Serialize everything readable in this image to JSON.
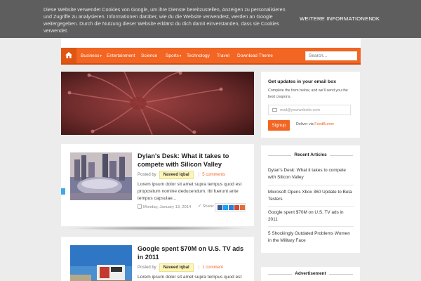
{
  "cookie": {
    "text": "Diese Website verwendet Cookies von Google, um ihre Dienste bereitzustellen, Anzeigen zu personalisieren und Zugriffe zu analysieren. Informationen darüber, wie du die Website verwendest, werden an Google weitergegeben. Durch die Nutzung dieser Website erklärst du dich damit einverstanden, dass sie Cookies verwendet.",
    "more_label": "WEITERE INFORMATIONEN",
    "ok_label": "OK"
  },
  "nav": {
    "home_icon": "home-icon",
    "items": [
      {
        "label": "Business",
        "caret": "▾"
      },
      {
        "label": "Entertainment"
      },
      {
        "label": "Science"
      },
      {
        "label": "Sports",
        "caret": "▾"
      },
      {
        "label": "Technology"
      },
      {
        "label": "Travel"
      },
      {
        "label": "Download Theme"
      }
    ],
    "search_placeholder": "Search..."
  },
  "posts": [
    {
      "title": "Dylan's Desk: What it takes to compete with Silicon Valley",
      "posted_by": "Posted by",
      "author": "Naveed Iqbal",
      "comments": "5 comments",
      "excerpt": "Lorem ipsum dolor sit amet supra tempus quod est propositum nomine deducendum. Ibi fuerunt ante tempus capsulae...",
      "date": "Monday, January 13, 2014",
      "share_label": "Share:"
    },
    {
      "title": "Google spent $70M on U.S. TV ads in 2011",
      "posted_by": "Posted by",
      "author": "Naveed Iqbal",
      "comments": "1 comment",
      "excerpt": "Lorem ipsum dolor sit amet supra tempus quod est"
    }
  ],
  "subscribe": {
    "title": "Get updates in your email box",
    "desc": "Complete the form below, and we'll send you the best coupons.",
    "email_placeholder": "mail@yourwebsite.com",
    "signup_label": "Signup",
    "deliver_prefix": "Deliver via",
    "deliver_link": "FeedBurner"
  },
  "recent": {
    "title": "Recent Articles",
    "items": [
      "Dylan's Desk: What it takes to compete with Silicon Valley",
      "Microsoft Opens Xbox 360 Update to Beta Testers",
      "Google spent $70M on U.S. TV ads in 2011",
      "5 Shockingly Outdated Problems Women in the Military Face"
    ]
  },
  "advert": {
    "title": "Advertisement"
  },
  "colors": {
    "accent": "#f26522",
    "cookie_bg": "#5e5e5e",
    "page_bg": "#ececec"
  }
}
